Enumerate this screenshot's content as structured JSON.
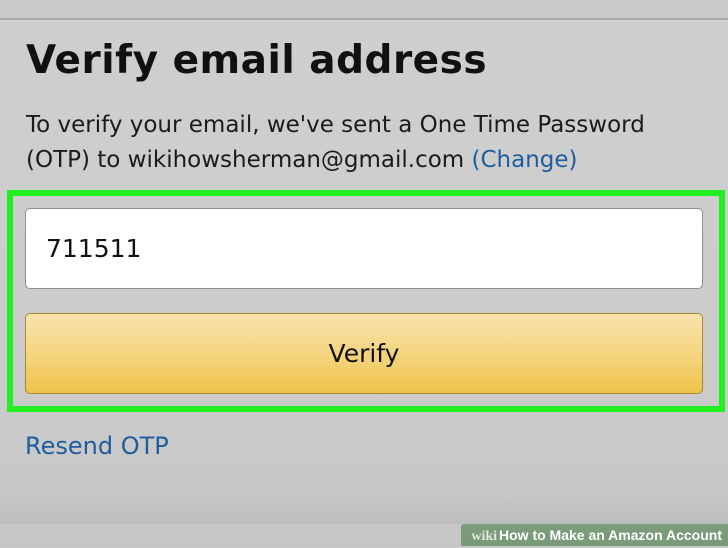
{
  "page": {
    "title": "Verify email address",
    "description": "To verify your email, we've sent a One Time Password (OTP) to wikihowsherman@gmail.com",
    "change_link": "(Change)"
  },
  "otp_input": {
    "value": "711511"
  },
  "verify_button": {
    "label": "Verify"
  },
  "resend_link": "Resend OTP",
  "watermark": {
    "brand": "wiki",
    "text": "How to Make an Amazon Account"
  },
  "colors": {
    "highlight": "#22ee22",
    "link": "#1e5d9e",
    "button": "#f4d37a",
    "background": "#cbcbcb"
  }
}
